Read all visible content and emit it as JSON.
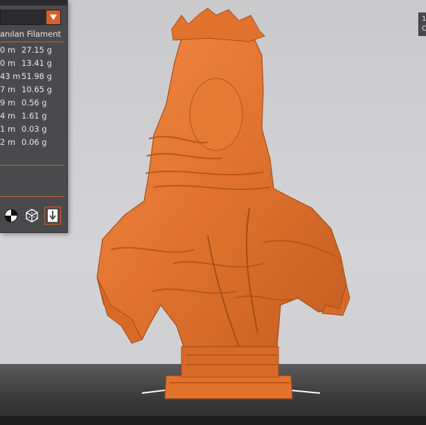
{
  "material": {
    "selected": ""
  },
  "stats": {
    "header": "anılan Filament",
    "rows": [
      {
        "length": "0 m",
        "weight": "27.15 g"
      },
      {
        "length": "0 m",
        "weight": "13.41 g"
      },
      {
        "length": "43 m",
        "weight": "51.98 g"
      },
      {
        "length": "7 m",
        "weight": "10.65 g"
      },
      {
        "length": "9 m",
        "weight": "0.56 g"
      },
      {
        "length": "4 m",
        "weight": "1.61 g"
      },
      {
        "length": "1 m",
        "weight": "0.03 g"
      },
      {
        "length": "2 m",
        "weight": "0.06 g"
      }
    ]
  },
  "view_buttons": [
    "center-view-icon",
    "3d-view-icon",
    "download-icon"
  ],
  "right_widget": {
    "line1": "1",
    "line2": "C"
  },
  "colors": {
    "accent": "#d4622a",
    "model": "#e1732f",
    "panel": "#4a4a4c",
    "bed": "#3b3b3b"
  }
}
